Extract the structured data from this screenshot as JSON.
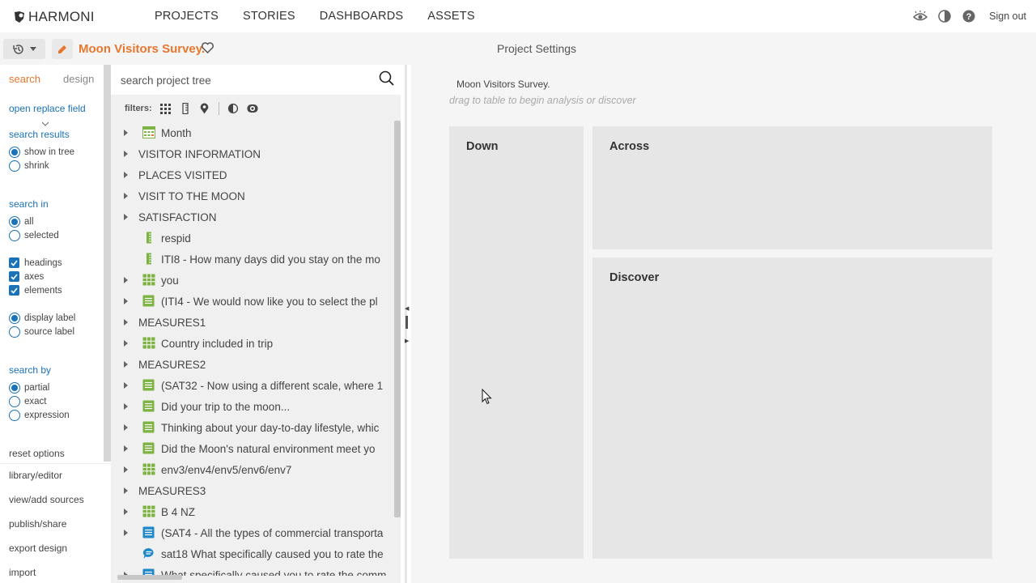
{
  "brand": {
    "name": "HARMONI"
  },
  "nav": {
    "items": [
      "PROJECTS",
      "STORIES",
      "DASHBOARDS",
      "ASSETS"
    ]
  },
  "account": {
    "sign_out": "Sign out"
  },
  "project": {
    "title": "Moon Visitors Survey.",
    "settings_label": "Project Settings"
  },
  "options_panel": {
    "tabs": {
      "search": "search",
      "design": "design"
    },
    "open_replace": "open replace field",
    "search_results": {
      "heading": "search results",
      "show_in_tree": "show in tree",
      "shrink": "shrink"
    },
    "search_in": {
      "heading": "search in",
      "all": "all",
      "selected": "selected"
    },
    "checks": {
      "headings": "headings",
      "axes": "axes",
      "elements": "elements"
    },
    "labels": {
      "display": "display label",
      "source": "source label"
    },
    "search_by": {
      "heading": "search by",
      "partial": "partial",
      "exact": "exact",
      "expression": "expression"
    },
    "actions": {
      "reset": "reset options",
      "library": "library/editor",
      "sources": "view/add sources",
      "publish": "publish/share",
      "export": "export design",
      "import": "import"
    }
  },
  "tree": {
    "search_placeholder": "search project tree",
    "filters_label": "filters:",
    "rows": [
      {
        "label": "Month",
        "caret": true,
        "icon": "calendar-grid-icon"
      },
      {
        "label": "VISITOR INFORMATION",
        "caret": true,
        "icon": ""
      },
      {
        "label": "PLACES VISITED",
        "caret": true,
        "icon": ""
      },
      {
        "label": "VISIT TO THE MOON",
        "caret": true,
        "icon": ""
      },
      {
        "label": "SATISFACTION",
        "caret": true,
        "icon": ""
      },
      {
        "label": "respid",
        "caret": false,
        "icon": "ruler-icon"
      },
      {
        "label": "ITI8 - How many days did you stay on the mo",
        "caret": false,
        "icon": "ruler-icon"
      },
      {
        "label": "you",
        "caret": true,
        "icon": "grid-icon"
      },
      {
        "label": "(ITI4 - We would now like you to select the pl",
        "caret": true,
        "icon": "list-icon"
      },
      {
        "label": "MEASURES1",
        "caret": true,
        "icon": ""
      },
      {
        "label": "Country included in trip",
        "caret": true,
        "icon": "grid-icon"
      },
      {
        "label": "MEASURES2",
        "caret": true,
        "icon": ""
      },
      {
        "label": "(SAT32 - Now using a different scale, where 1",
        "caret": true,
        "icon": "list-icon"
      },
      {
        "label": "Did your trip to the moon...",
        "caret": true,
        "icon": "list-icon"
      },
      {
        "label": "Thinking about your day-to-day lifestyle, whic",
        "caret": true,
        "icon": "list-icon"
      },
      {
        "label": "Did the Moon's natural environment meet yo",
        "caret": true,
        "icon": "list-icon"
      },
      {
        "label": "env3/env4/env5/env6/env7",
        "caret": true,
        "icon": "grid-icon"
      },
      {
        "label": "MEASURES3",
        "caret": true,
        "icon": ""
      },
      {
        "label": "B 4 NZ",
        "caret": true,
        "icon": "grid-icon"
      },
      {
        "label": "(SAT4 - All the types of commercial transporta",
        "caret": true,
        "icon": "list-blue-icon"
      },
      {
        "label": "sat18 What specifically caused you to rate the",
        "caret": false,
        "icon": "speech-bubble-icon"
      },
      {
        "label": "What specifically caused you to rate the comm",
        "caret": true,
        "icon": "list-blue-icon"
      }
    ]
  },
  "main": {
    "title": "Moon Visitors Survey.",
    "hint": "drag to table to begin analysis or discover",
    "zones": {
      "down": "Down",
      "across": "Across",
      "discover": "Discover"
    }
  },
  "colors": {
    "accent": "#e8772e",
    "link": "#1a72b8",
    "icon_green": "#7cb342",
    "icon_blue": "#1e88c8"
  }
}
